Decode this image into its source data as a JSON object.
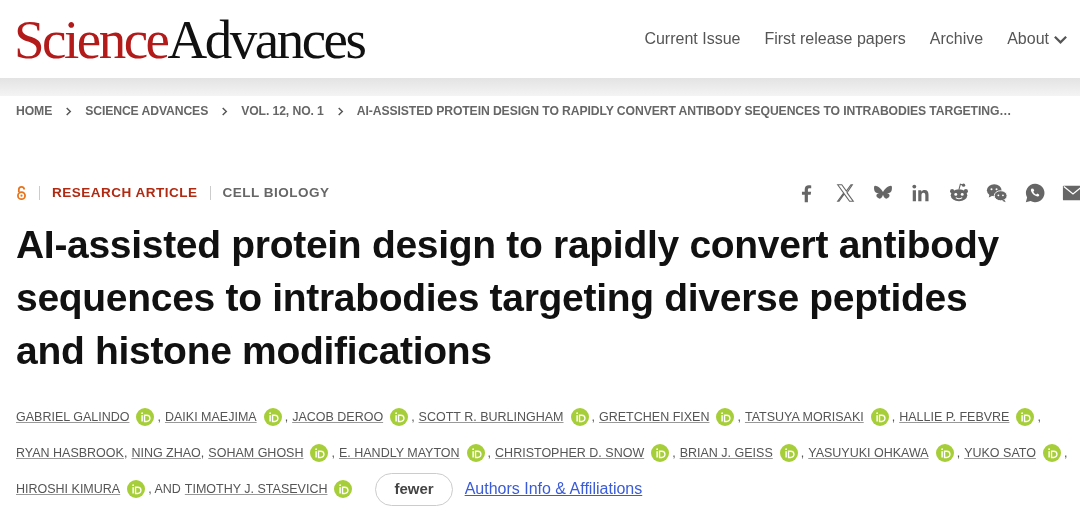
{
  "logo": {
    "first": "Science",
    "second": "Advances"
  },
  "nav": [
    {
      "label": "Current Issue",
      "dropdown": false
    },
    {
      "label": "First release papers",
      "dropdown": false
    },
    {
      "label": "Archive",
      "dropdown": false
    },
    {
      "label": "About",
      "dropdown": true
    }
  ],
  "breadcrumb": [
    "HOME",
    "SCIENCE ADVANCES",
    "VOL. 12, NO. 1",
    "AI-ASSISTED PROTEIN DESIGN TO RAPIDLY CONVERT ANTIBODY SEQUENCES TO INTRABODIES TARGETING…"
  ],
  "article": {
    "open_access": true,
    "type": "RESEARCH ARTICLE",
    "subject": "CELL BIOLOGY",
    "share": [
      {
        "kind": "facebook"
      },
      {
        "kind": "x"
      },
      {
        "kind": "bluesky"
      },
      {
        "kind": "linkedin"
      },
      {
        "kind": "reddit"
      },
      {
        "kind": "wechat"
      },
      {
        "kind": "whatsapp"
      },
      {
        "kind": "email"
      }
    ],
    "title": "AI-assisted protein design to rapidly convert antibody sequences to intrabodies targeting diverse peptides and histone modifications",
    "author_lines": [
      [
        {
          "name": "GABRIEL GALINDO",
          "orcid": true,
          "after": ","
        },
        {
          "name": "DAIKI MAEJIMA",
          "orcid": true,
          "after": ","
        },
        {
          "name": "JACOB DEROO",
          "orcid": true,
          "after": ","
        },
        {
          "name": "SCOTT R. BURLINGHAM",
          "orcid": true,
          "after": ","
        },
        {
          "name": "GRETCHEN FIXEN",
          "orcid": true,
          "after": ","
        },
        {
          "name": "TATSUYA MORISAKI",
          "orcid": true,
          "after": ","
        },
        {
          "name": "HALLIE P. FEBVRE",
          "orcid": true,
          "after": ","
        }
      ],
      [
        {
          "name": "RYAN HASBROOK",
          "orcid": false,
          "after": ","
        },
        {
          "name": "NING ZHAO",
          "orcid": false,
          "after": ","
        },
        {
          "name": "SOHAM GHOSH",
          "orcid": true,
          "after": ","
        },
        {
          "name": "E. HANDLY MAYTON",
          "orcid": true,
          "after": ","
        },
        {
          "name": "CHRISTOPHER D. SNOW",
          "orcid": true,
          "after": ","
        },
        {
          "name": "BRIAN J. GEISS",
          "orcid": true,
          "after": ","
        },
        {
          "name": "YASUYUKI OHKAWA",
          "orcid": true,
          "after": ","
        },
        {
          "name": "YUKO SATO",
          "orcid": true,
          "after": ","
        }
      ],
      [
        {
          "name": "HIROSHI KIMURA",
          "orcid": true,
          "after": ", AND"
        },
        {
          "name": "TIMOTHY J. STASEVICH",
          "orcid": true
        }
      ]
    ],
    "fewer_button": "fewer",
    "affiliations_link": "Authors Info & Affiliations"
  }
}
